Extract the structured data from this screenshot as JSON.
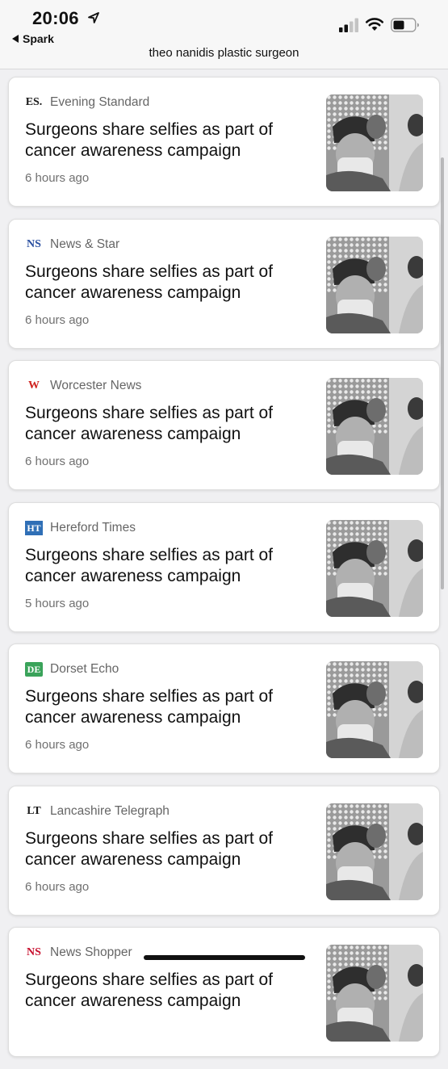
{
  "status": {
    "time": "20:06",
    "back_app": "Spark"
  },
  "page_title": "theo nanidis plastic surgeon",
  "articles": [
    {
      "logo_text": "ES.",
      "logo_color": "#1a1a1a",
      "source": "Evening Standard",
      "headline": "Surgeons share selfies as part of cancer awareness campaign",
      "age": "6 hours ago"
    },
    {
      "logo_text": "NS",
      "logo_color": "#2a4fa0",
      "source": "News & Star",
      "headline": "Surgeons share selfies as part of cancer awareness campaign",
      "age": "6 hours ago"
    },
    {
      "logo_text": "W",
      "logo_color": "#d0231f",
      "source": "Worcester News",
      "headline": "Surgeons share selfies as part of cancer awareness campaign",
      "age": "6 hours ago"
    },
    {
      "logo_text": "HT",
      "logo_color": "#2f6fb6",
      "source": "Hereford Times",
      "headline": "Surgeons share selfies as part of cancer awareness campaign",
      "age": "5 hours ago"
    },
    {
      "logo_text": "DE",
      "logo_color": "#3aa35a",
      "source": "Dorset Echo",
      "headline": "Surgeons share selfies as part of cancer awareness campaign",
      "age": "6 hours ago"
    },
    {
      "logo_text": "LT",
      "logo_color": "#1a1a1a",
      "source": "Lancashire Telegraph",
      "headline": "Surgeons share selfies as part of cancer awareness campaign",
      "age": "6 hours ago"
    },
    {
      "logo_text": "NS",
      "logo_color": "#c8102e",
      "source": "News Shopper",
      "headline": "Surgeons share selfies as part of cancer awareness campaign",
      "age": ""
    }
  ]
}
